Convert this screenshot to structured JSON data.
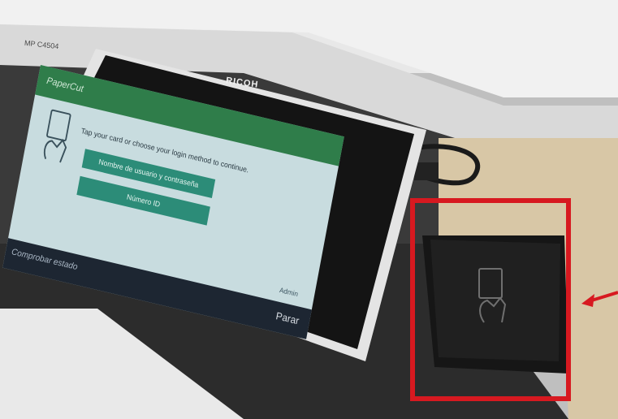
{
  "device": {
    "brand": "RICOH",
    "model_label": "MP C4504"
  },
  "tablet": {
    "app_title": "PaperCut",
    "prompt": "Tap your card or choose your login method to continue.",
    "buttons": [
      "Nombre de usuario y contraseña",
      "Número ID"
    ],
    "admin_label": "Admin",
    "status_label": "Comprobar estado",
    "stop_label": "Parar"
  },
  "colors": {
    "highlight_box": "#d71920",
    "arrow": "#d71920",
    "screen_header": "#2f7d4a",
    "screen_button": "#2c8c78"
  }
}
